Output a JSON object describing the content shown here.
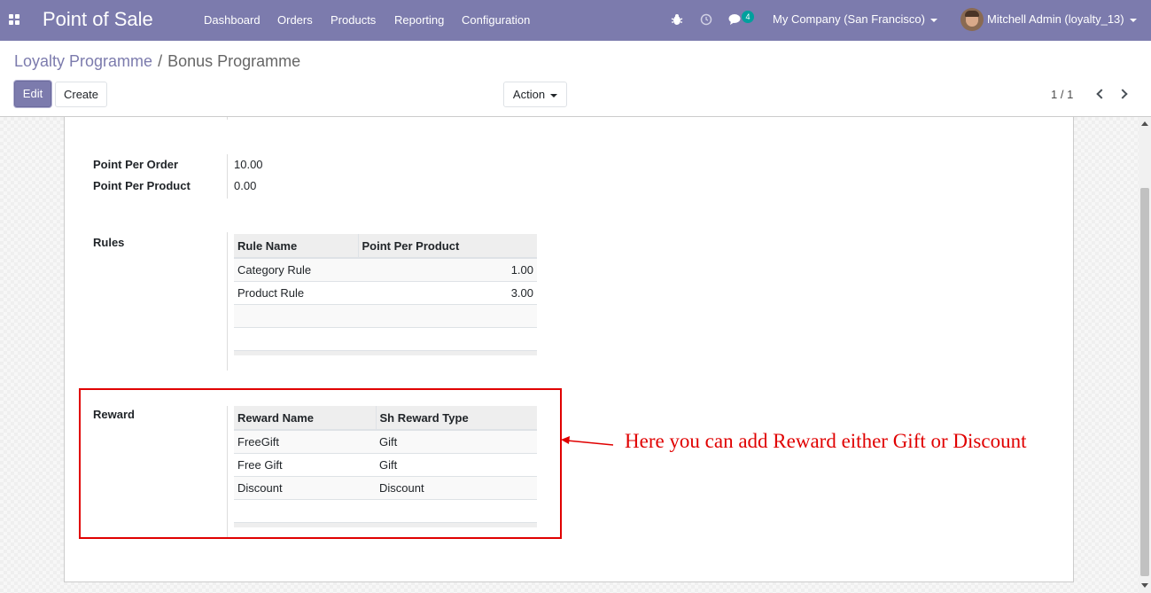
{
  "navbar": {
    "app_title": "Point of Sale",
    "menu": [
      "Dashboard",
      "Orders",
      "Products",
      "Reporting",
      "Configuration"
    ],
    "message_count": "4",
    "company": "My Company (San Francisco)",
    "user": "Mitchell Admin (loyalty_13)"
  },
  "breadcrumb": {
    "parent": "Loyalty Programme",
    "separator": "/",
    "current": "Bonus Programme"
  },
  "toolbar": {
    "edit_label": "Edit",
    "create_label": "Create",
    "action_label": "Action",
    "pager": "1 / 1"
  },
  "form": {
    "point_per_order_label": "Point Per Order",
    "point_per_order_value": "10.00",
    "point_per_product_label": "Point Per Product",
    "point_per_product_value": "0.00",
    "rules": {
      "label": "Rules",
      "columns": [
        "Rule Name",
        "Point Per Product"
      ],
      "rows": [
        {
          "name": "Category Rule",
          "points": "1.00"
        },
        {
          "name": "Product Rule",
          "points": "3.00"
        }
      ]
    },
    "reward": {
      "label": "Reward",
      "columns": [
        "Reward Name",
        "Sh Reward Type"
      ],
      "rows": [
        {
          "name": "FreeGift",
          "type": "Gift"
        },
        {
          "name": "Free Gift",
          "type": "Gift"
        },
        {
          "name": "Discount",
          "type": "Discount"
        }
      ]
    }
  },
  "annotation": {
    "text": "Here you can add Reward either Gift or Discount",
    "color": "#e00000"
  },
  "colors": {
    "brand": "#7c7bad",
    "badge": "#00a09d"
  },
  "icons": [
    "apps-icon",
    "bug-icon",
    "clock-icon",
    "chat-icon",
    "chevron-left-icon",
    "chevron-right-icon"
  ]
}
